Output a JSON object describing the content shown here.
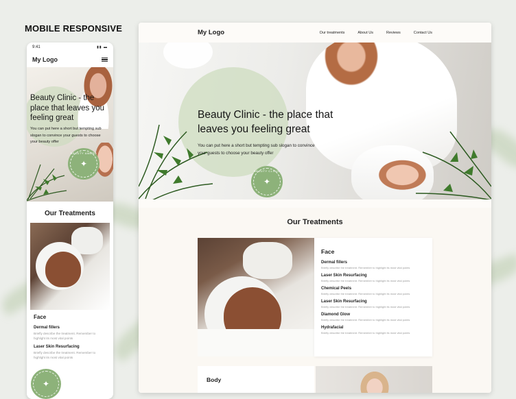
{
  "page_title": "MOBILE RESPONSIVE",
  "colors": {
    "accent_green": "#8db27a",
    "blob_green": "#cddcbf",
    "background": "#eceeea"
  },
  "mobile": {
    "time": "9:41",
    "logo": "My Logo",
    "menu_icon": "hamburger-icon",
    "hero_title": "Beauty Clinic - the place that leaves you feeling great",
    "hero_text": "You can put here a short but tempting sub slogan to convince your guests to choose your beauty offer",
    "badge_text": "BEAUTY AWARD",
    "treatments_title": "Our Treatments",
    "card_title": "Face",
    "items": [
      {
        "title": "Dermal fillers",
        "desc": "Briefly describe the treatment. Remember to highlight its most vital points"
      },
      {
        "title": "Laser Skin Resurfacing",
        "desc": "Briefly describe the treatment. Remember to highlight its most vital points"
      }
    ]
  },
  "desktop": {
    "logo": "My Logo",
    "nav": [
      "Our treatments",
      "About Us",
      "Reviews",
      "Contact Us"
    ],
    "hero_title": "Beauty Clinic - the place that leaves you feeling great",
    "hero_text": "You can put here a short but tempting sub slogan to convince your guests to choose your beauty offer",
    "badge_text": "BEAUTY CLINIC",
    "treatments_title": "Our Treatments",
    "card_title": "Face",
    "items": [
      {
        "title": "Dermal fillers",
        "desc": "Briefly describe the treatment. Remember to highlight its most vital points"
      },
      {
        "title": "Laser Skin Resurfacing",
        "desc": "Briefly describe the treatment. Remember to highlight its most vital points"
      },
      {
        "title": "Chemical Peels",
        "desc": "Briefly describe the treatment. Remember to highlight its most vital points"
      },
      {
        "title": "Laser Skin Resurfacing",
        "desc": "Briefly describe the treatment. Remember to highlight its most vital points"
      },
      {
        "title": "Diamond Glow",
        "desc": "Briefly describe the treatment. Remember to highlight its most vital points"
      },
      {
        "title": "Hydrafacial",
        "desc": "Briefly describe the treatment. Remember to highlight its most vital points"
      }
    ],
    "body_title": "Body"
  }
}
